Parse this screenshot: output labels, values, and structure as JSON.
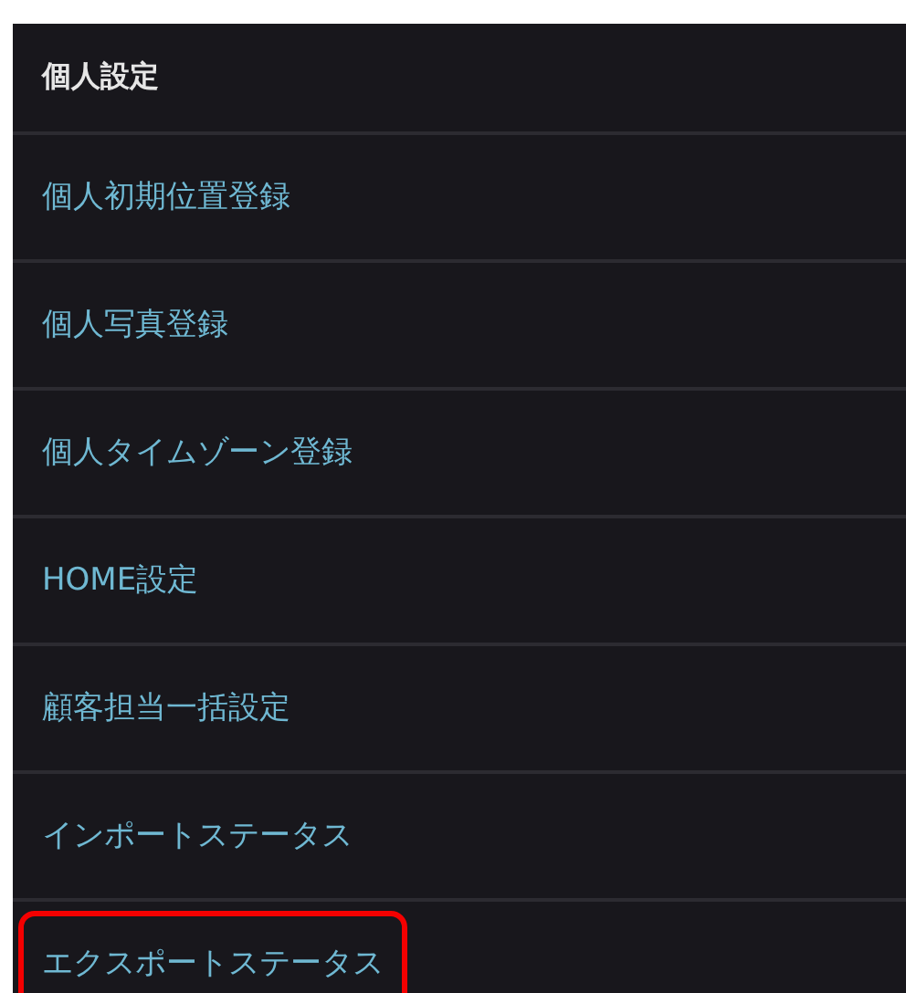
{
  "menu": {
    "title": "個人設定",
    "items": [
      {
        "label": "個人初期位置登録",
        "highlighted": false
      },
      {
        "label": "個人写真登録",
        "highlighted": false
      },
      {
        "label": "個人タイムゾーン登録",
        "highlighted": false
      },
      {
        "label": "HOME設定",
        "highlighted": false
      },
      {
        "label": "顧客担当一括設定",
        "highlighted": false
      },
      {
        "label": "インポートステータス",
        "highlighted": false
      },
      {
        "label": "エクスポートステータス",
        "highlighted": true
      }
    ]
  }
}
